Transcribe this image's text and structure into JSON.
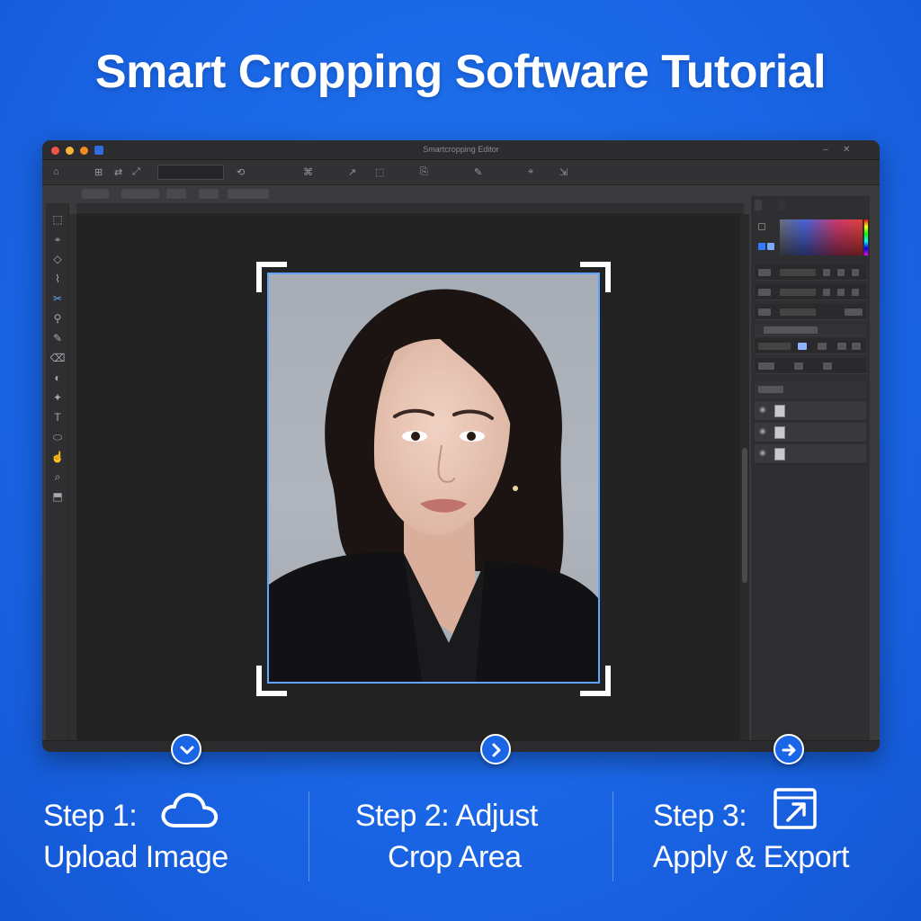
{
  "page": {
    "title": "Smart Cropping Software Tutorial"
  },
  "window": {
    "title": "Smartcropping Editor",
    "controls": [
      "–",
      "✕"
    ],
    "toolbar_glyphs": [
      "⌂",
      "⊞",
      "⇄",
      "⤢",
      "⟲",
      "⌘",
      "↗",
      "⬚",
      "⎘",
      "✎",
      "⌖",
      "⇲"
    ],
    "tabs": [
      "",
      "",
      "",
      "",
      ""
    ],
    "tools": [
      "⬚",
      "⌖",
      "◇",
      "⌇",
      "✂",
      "⚲",
      "✎",
      "⌫",
      "◐",
      "✦",
      "T",
      "⬭",
      "☝",
      "⌕",
      "⬒"
    ],
    "status": {
      "zoom": "",
      "info": ""
    }
  },
  "panels": {
    "tabs": [
      "",
      ""
    ],
    "layers": [
      {
        "name": ""
      },
      {
        "name": ""
      },
      {
        "name": ""
      }
    ]
  },
  "image": {
    "alt": "Portrait photo being cropped"
  },
  "steps": [
    {
      "line1": "Step 1:",
      "line2": "Upload Image",
      "icon": "cloud-icon"
    },
    {
      "line1": "Step 2: Adjust",
      "line2": "Crop Area",
      "icon": "none"
    },
    {
      "line1": "Step 3:",
      "line2": "Apply & Export",
      "icon": "export-icon"
    }
  ],
  "colors": {
    "background": "#1a66e6",
    "accent": "#5fa4ff",
    "window": "#3b3b3d",
    "canvas": "#232324"
  }
}
